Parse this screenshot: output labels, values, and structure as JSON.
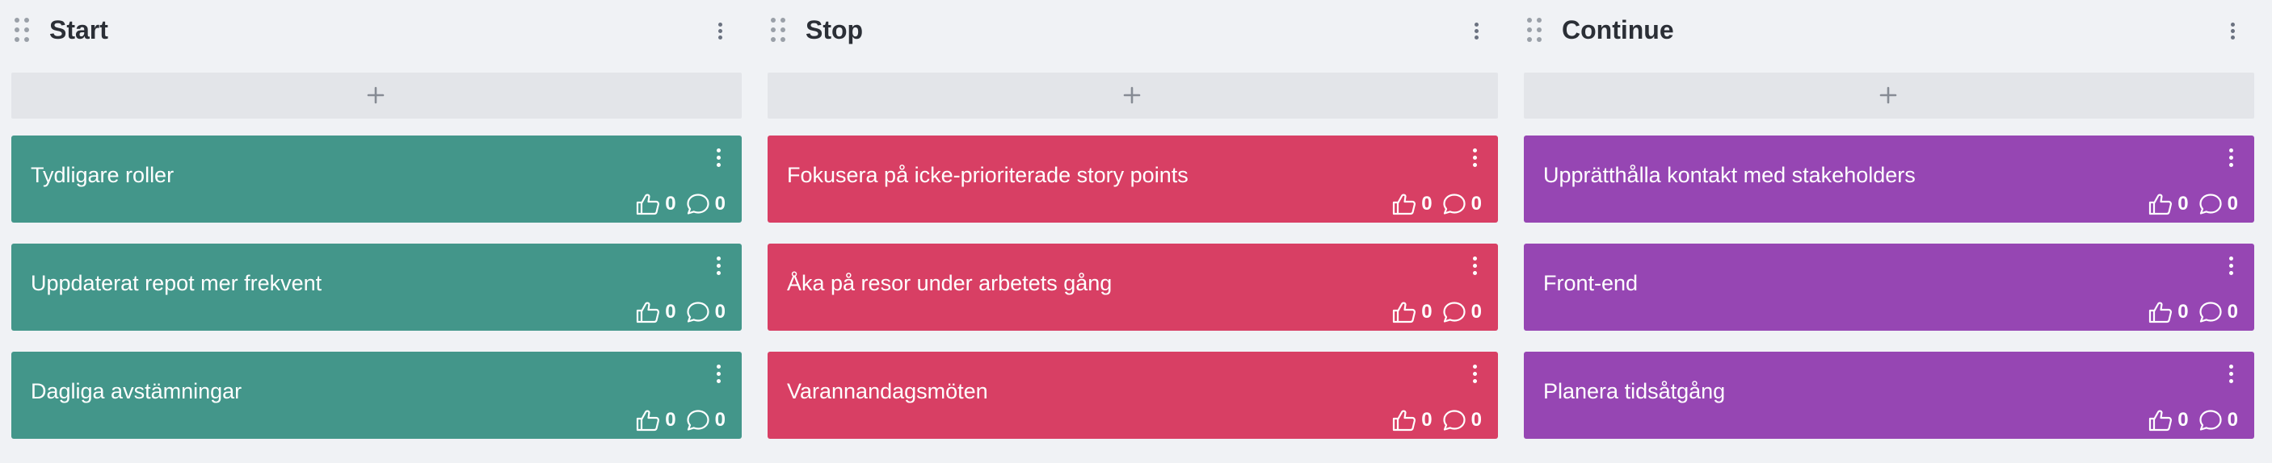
{
  "colors": {
    "start": "#43968a",
    "stop": "#d83f64",
    "continue": "#9646b3"
  },
  "columns": [
    {
      "title": "Start",
      "color": "#43968a",
      "cards": [
        {
          "text": "Tydligare roller",
          "likes": "0",
          "comments": "0"
        },
        {
          "text": "Uppdaterat repot mer frekvent",
          "likes": "0",
          "comments": "0"
        },
        {
          "text": "Dagliga avstämningar",
          "likes": "0",
          "comments": "0"
        }
      ]
    },
    {
      "title": "Stop",
      "color": "#d83f64",
      "cards": [
        {
          "text": "Fokusera på icke-prioriterade story points",
          "likes": "0",
          "comments": "0"
        },
        {
          "text": "Åka på resor under arbetets gång",
          "likes": "0",
          "comments": "0"
        },
        {
          "text": "Varannandagsmöten",
          "likes": "0",
          "comments": "0"
        }
      ]
    },
    {
      "title": "Continue",
      "color": "#9646b3",
      "cards": [
        {
          "text": "Upprätthålla kontakt med stakeholders",
          "likes": "0",
          "comments": "0"
        },
        {
          "text": "Front-end",
          "likes": "0",
          "comments": "0"
        },
        {
          "text": "Planera tidsåtgång",
          "likes": "0",
          "comments": "0"
        }
      ]
    }
  ],
  "icons": {
    "drag": "drag-handle-icon",
    "menu": "kebab-menu-icon",
    "add": "plus-icon",
    "like": "thumbs-up-icon",
    "comment": "comment-bubble-icon"
  }
}
